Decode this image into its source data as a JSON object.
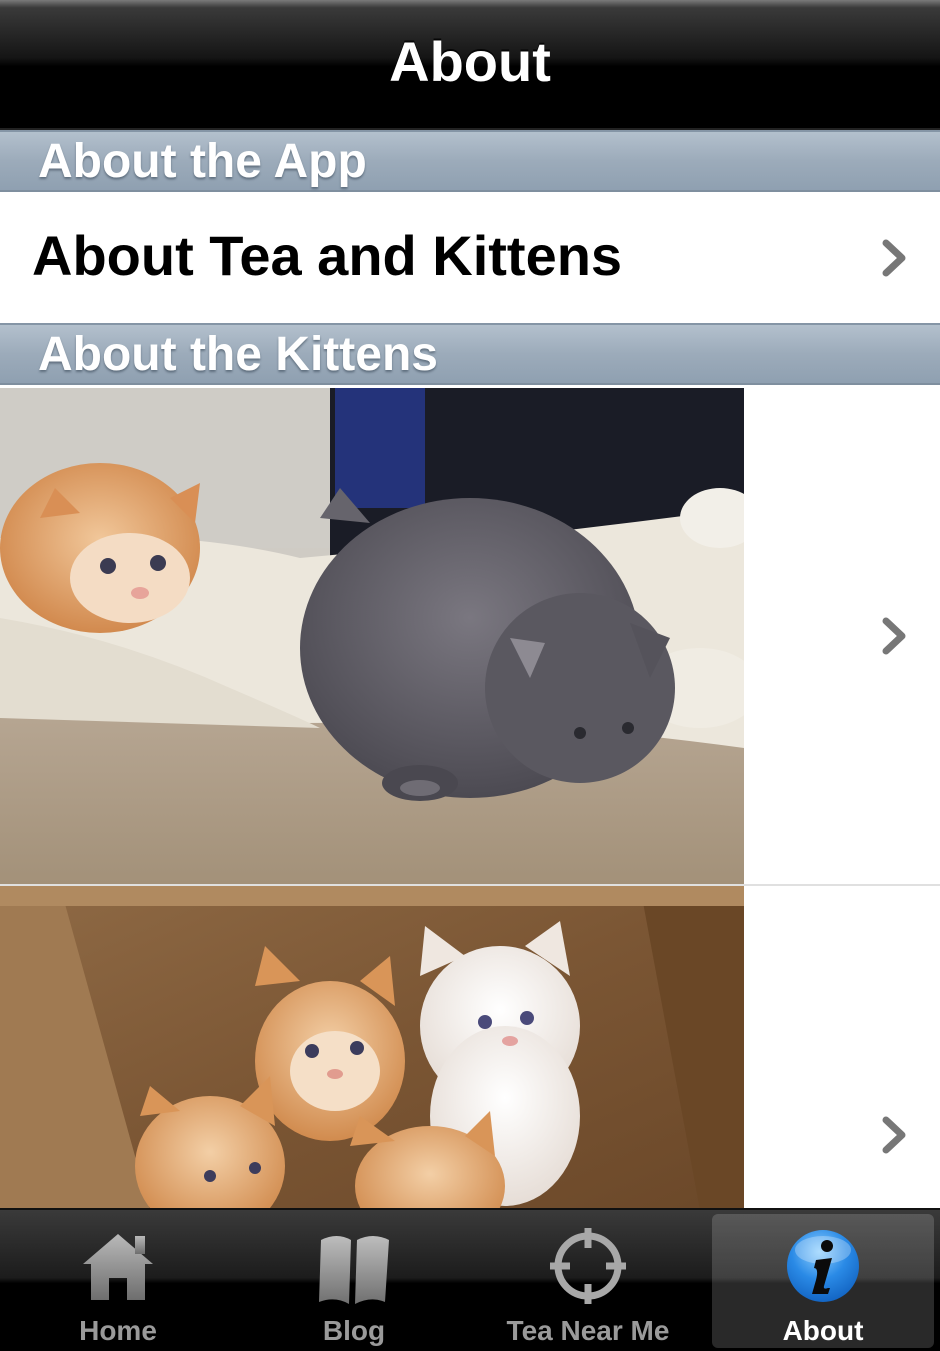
{
  "navbar": {
    "title": "About"
  },
  "sections": {
    "app": {
      "header": "About the App",
      "rows": [
        {
          "label": "About Tea and Kittens"
        }
      ]
    },
    "kittens": {
      "header": "About the Kittens",
      "rows": [
        {
          "image": "gray-and-orange-kittens-photo"
        },
        {
          "image": "kittens-in-box-photo"
        }
      ]
    }
  },
  "tabbar": {
    "selected": "About",
    "tabs": [
      {
        "label": "Home",
        "icon": "home-icon"
      },
      {
        "label": "Blog",
        "icon": "book-icon"
      },
      {
        "label": "Tea Near Me",
        "icon": "crosshair-icon"
      },
      {
        "label": "About",
        "icon": "info-icon"
      }
    ]
  },
  "colors": {
    "section_header": "#9cabba",
    "navbar": "#000000",
    "tabbar": "#1c1c1c",
    "selected_tab_icon": "#2a8ae6",
    "chevron": "#777777"
  }
}
